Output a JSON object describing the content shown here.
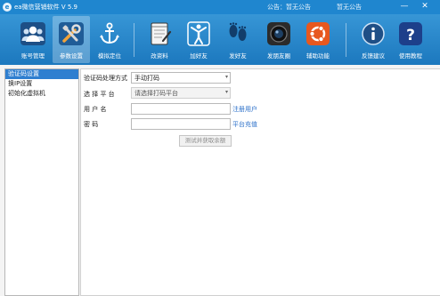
{
  "titlebar": {
    "app_title": "ea微信营销软件  V 5.9",
    "notice_label": "公告：暂无公告",
    "notice_text": "暂无公告",
    "min_glyph": "—",
    "close_glyph": "✕"
  },
  "toolbar": {
    "items": [
      {
        "label": "账号管理",
        "icon": "users-icon"
      },
      {
        "label": "参数设置",
        "icon": "tools-icon",
        "active": true
      },
      {
        "label": "模拟定位",
        "icon": "anchor-icon"
      },
      {
        "label": "改资料",
        "icon": "notebook-pen-icon"
      },
      {
        "label": "加好友",
        "icon": "person-raise-icon"
      },
      {
        "label": "发好友",
        "icon": "footprints-icon"
      },
      {
        "label": "发朋友圈",
        "icon": "camera-lens-icon"
      },
      {
        "label": "辅助功能",
        "icon": "ubuntu-icon"
      },
      {
        "label": "反馈建议",
        "icon": "info-icon"
      },
      {
        "label": "使用教程",
        "icon": "help-icon"
      }
    ]
  },
  "sidebar": {
    "items": [
      {
        "label": "验证码设置",
        "selected": true
      },
      {
        "label": "换IP设置"
      },
      {
        "label": "初始化虚拟机"
      }
    ]
  },
  "form": {
    "captcha_method_label": "验证码处理方式",
    "captcha_method_value": "手动打码",
    "platform_label": "选 择 平 台",
    "platform_value": "请选择打码平台",
    "username_label": "用     户     名",
    "username_value": "",
    "register_link": "注册用户",
    "password_label": "密             码",
    "password_value": "",
    "recharge_link": "平台充值",
    "test_button": "测试并获取余额"
  },
  "colors": {
    "titlebar": "#1f86cf",
    "toolbar_top": "#3796d6",
    "toolbar_bottom": "#1c78be",
    "selected": "#2f7fd0",
    "link": "#2a6fc9"
  }
}
